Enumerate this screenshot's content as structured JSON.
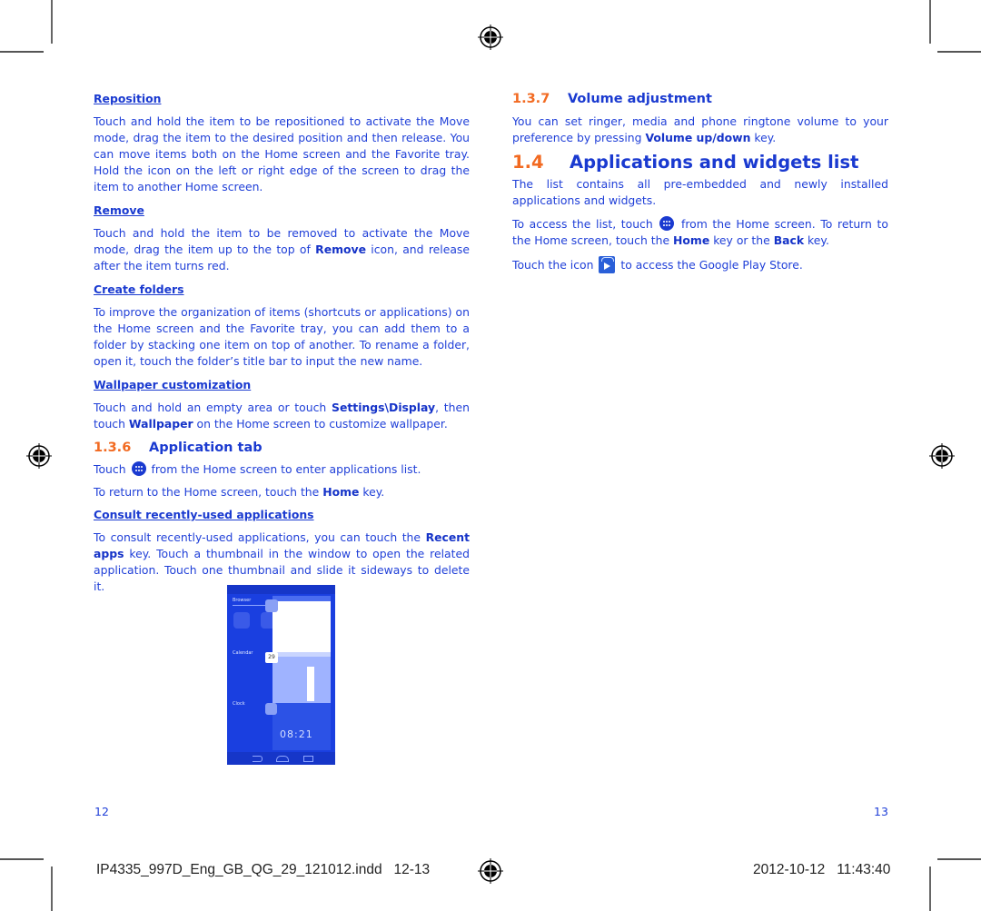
{
  "left_page": {
    "sections": {
      "reposition": {
        "title": "Reposition",
        "body": "Touch and hold the item to be repositioned to activate the Move mode, drag the item to the desired position and then release. You can move items both on the Home screen and the Favorite tray. Hold the icon on the left or right edge of the screen to drag the item to another Home screen."
      },
      "remove": {
        "title": "Remove",
        "body_pre": "Touch and hold the item to be removed to activate the Move mode, drag the item up to the top of ",
        "body_bold": "Remove",
        "body_post": " icon, and release after the item turns red."
      },
      "create_folders": {
        "title": "Create folders",
        "body": "To improve the organization of items (shortcuts or applications) on the Home screen and the Favorite tray, you can add them to a folder by stacking one item on top of another. To rename a folder, open it, touch the folder’s title bar to input the new name."
      },
      "wallpaper": {
        "title": "Wallpaper customization",
        "body_1": "Touch and hold an empty area or touch ",
        "bold_1": "Settings\\Display",
        "body_2": ", then touch ",
        "bold_2": "Wallpaper",
        "body_3": " on the Home screen to customize wallpaper."
      }
    },
    "application_tab": {
      "number": "1.3.6",
      "title": "Application tab",
      "line1_pre": "Touch",
      "line1_post": "from the Home screen to enter applications list.",
      "line2_pre": "To return to the Home screen, touch the ",
      "line2_bold": "Home",
      "line2_post": " key.",
      "recent": {
        "title": "Consult recently-used applications",
        "body_pre": "To consult recently-used applications, you can touch the ",
        "body_bold": "Recent apps",
        "body_post": " key. Touch a thumbnail in the window to open the related application. Touch one thumbnail and slide it sideways to delete it."
      }
    },
    "screenshot": {
      "labels": [
        "Browser",
        "Calendar",
        "Clock"
      ],
      "calendar_day": "29",
      "clock_time": "08:21"
    },
    "page_number": "12"
  },
  "right_page": {
    "volume": {
      "number": "1.3.7",
      "title": "Volume adjustment",
      "body_pre": "You can set ringer, media and phone ringtone volume to your preference by pressing ",
      "body_bold": "Volume up/down",
      "body_post": " key."
    },
    "apps_widgets": {
      "number": "1.4",
      "title": "Applications and widgets list",
      "para1": "The list contains all pre-embedded and newly installed applications and widgets.",
      "para2_pre": "To access the list, touch",
      "para2_mid": "from the Home screen. To return to the Home screen, touch the ",
      "para2_bold1": "Home",
      "para2_mid2": " key or the ",
      "para2_bold2": "Back",
      "para2_post": " key.",
      "para3_pre": "Touch the icon",
      "para3_post": "to access the Google Play Store."
    },
    "page_number": "13"
  },
  "slug": {
    "filename": "IP4335_997D_Eng_GB_QG_29_121012.indd   12-13",
    "timestamp": "2012-10-12   11:43:40"
  },
  "colors": {
    "body_text": "#1f3fd8",
    "section_number": "#f26a21",
    "heading": "#1a3ad0"
  }
}
